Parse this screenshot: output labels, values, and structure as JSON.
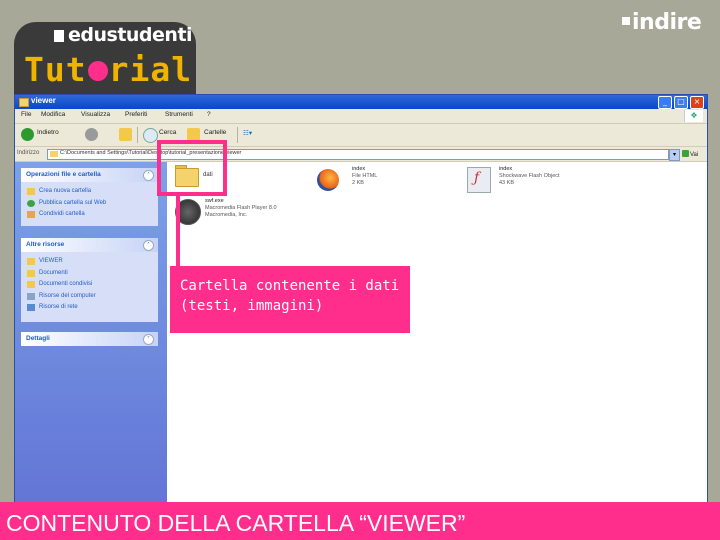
{
  "branding": {
    "site_logo": "edustudenti",
    "section_logo": "Tutorial",
    "corner_logo": "indire"
  },
  "window": {
    "title": "viewer",
    "controls": [
      "_",
      "□",
      "×"
    ],
    "menu": [
      "File",
      "Modifica",
      "Visualizza",
      "Preferiti",
      "Strumenti",
      "?"
    ],
    "toolbar": {
      "back": "Indietro",
      "search": "Cerca",
      "folders": "Cartelle",
      "views": "☷▾"
    },
    "address": {
      "label": "Indirizzo",
      "path": "C:\\Documents and Settings\\Tutorial\\Desktop\\tutorial_presentazione\\viewer",
      "go": "Vai"
    }
  },
  "task_pane": {
    "file_tasks": {
      "title": "Operazioni file e cartella",
      "items": [
        "Crea nuova cartella",
        "Pubblica cartella sul Web",
        "Condividi cartella"
      ]
    },
    "other_places": {
      "title": "Altre risorse",
      "items": [
        "VIEWER",
        "Documenti",
        "Documenti condivisi",
        "Risorse del computer",
        "Risorse di rete"
      ]
    },
    "details": {
      "title": "Dettagli"
    }
  },
  "files": {
    "folder": {
      "name": "dati"
    },
    "html_file": {
      "name": "index",
      "type": "File HTML",
      "size": "2 KB"
    },
    "flash_file": {
      "name": "index",
      "type": "Shockwave Flash Object",
      "size": "43 KB"
    },
    "player": {
      "name": "swf.exe",
      "desc": "Macromedia Flash Player 8.0",
      "company": "Macromedia, Inc."
    }
  },
  "annotation": {
    "callout": "Cartella contenente i dati (testi, immagini)"
  },
  "caption": "CONTENUTO DELLA CARTELLA “VIEWER”",
  "colors": {
    "accent_pink": "#ff2d8c",
    "logo_gold": "#f0b400",
    "xp_blue": "#0a46c8",
    "background": "#a8a898"
  }
}
